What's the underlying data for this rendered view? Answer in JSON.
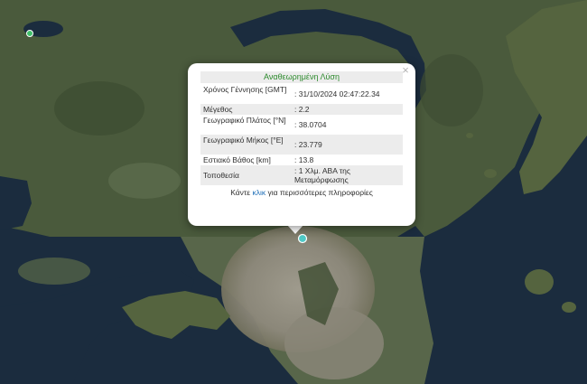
{
  "popup": {
    "title": "Αναθεωρημένη Λύση",
    "close_symbol": "×",
    "rows": [
      {
        "label": "Χρόνος Γέννησης [GMT]",
        "value": ": 31/10/2024 02:47:22.34"
      },
      {
        "label": "Μέγεθος",
        "value": ": 2.2"
      },
      {
        "label": "Γεωγραφικό Πλάτος [°N]",
        "value": ": 38.0704"
      },
      {
        "label": "Γεωγραφικό Μήκος [°E]",
        "value": ": 23.779"
      },
      {
        "label": "Εστιακό Βάθος [km]",
        "value": ": 13.8"
      },
      {
        "label": "Τοποθεσία",
        "value": ": 1 Χλμ. ΑΒΑ της Μεταμόρφωσης"
      }
    ],
    "footer_before": "Κάντε ",
    "footer_link": "κλικ",
    "footer_after": " για περισσότερες πληροφορίες"
  },
  "colors": {
    "sea": "#1b2c3e",
    "land": "#4a5a3c",
    "urban": "#8c887c",
    "popup_title_text": "#2e8b2e",
    "link": "#1f6fb8",
    "marker": "#4fc9c6",
    "marker_green": "#3fbf6a"
  }
}
